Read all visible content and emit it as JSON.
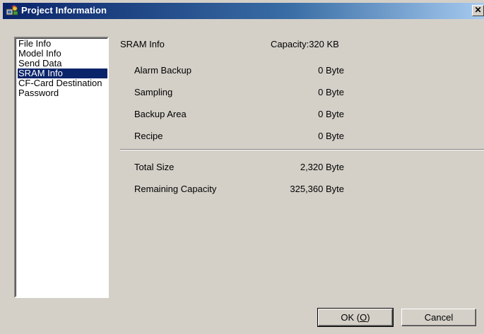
{
  "window": {
    "title": "Project Information",
    "close_label": "✕"
  },
  "nav": {
    "items": [
      {
        "label": "File Info"
      },
      {
        "label": "Model Info"
      },
      {
        "label": "Send Data"
      },
      {
        "label": "SRAM Info",
        "selected": true
      },
      {
        "label": "CF-Card Destination"
      },
      {
        "label": "Password"
      }
    ]
  },
  "sram": {
    "header_label": "SRAM Info",
    "capacity": "Capacity:320 KB",
    "rows": [
      {
        "label": "Alarm Backup",
        "value": "0 Byte"
      },
      {
        "label": "Sampling",
        "value": "0 Byte"
      },
      {
        "label": "Backup Area",
        "value": "0 Byte"
      },
      {
        "label": "Recipe",
        "value": "0 Byte"
      }
    ],
    "totals": [
      {
        "label": "Total Size",
        "value": "2,320 Byte"
      },
      {
        "label": "Remaining Capacity",
        "value": "325,360 Byte"
      }
    ]
  },
  "buttons": {
    "ok": "OK (O)",
    "cancel": "Cancel"
  },
  "colors": {
    "selection": "#0a246a",
    "titlebar_start": "#0a246a",
    "face": "#d4d0c8"
  }
}
